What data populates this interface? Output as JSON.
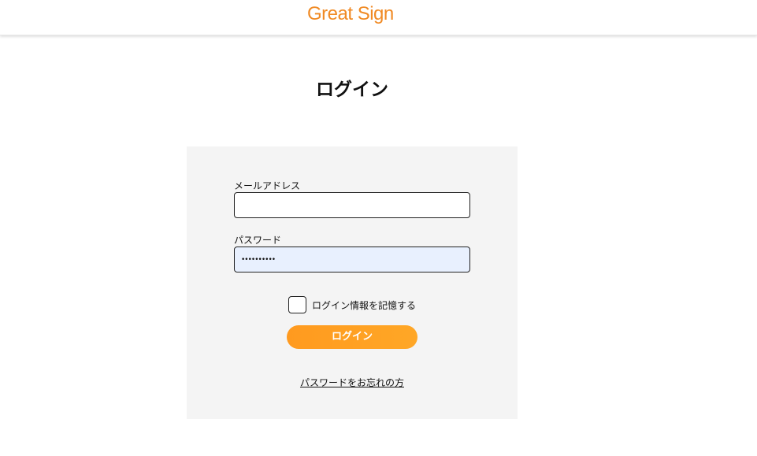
{
  "header": {
    "logo_text": "Great Sign"
  },
  "page": {
    "title": "ログイン"
  },
  "form": {
    "email_label": "メールアドレス",
    "email_value": "",
    "password_label": "パスワード",
    "password_value": "••••••••••",
    "remember_label": "ログイン情報を記憶する",
    "remember_checked": false,
    "login_button_label": "ログイン",
    "forgot_password_link": "パスワードをお忘れの方"
  },
  "colors": {
    "brand": "#f08a24",
    "button": "#ff9a1f",
    "card_background": "#f4f4f4",
    "autofill_background": "#e8f0fe"
  }
}
